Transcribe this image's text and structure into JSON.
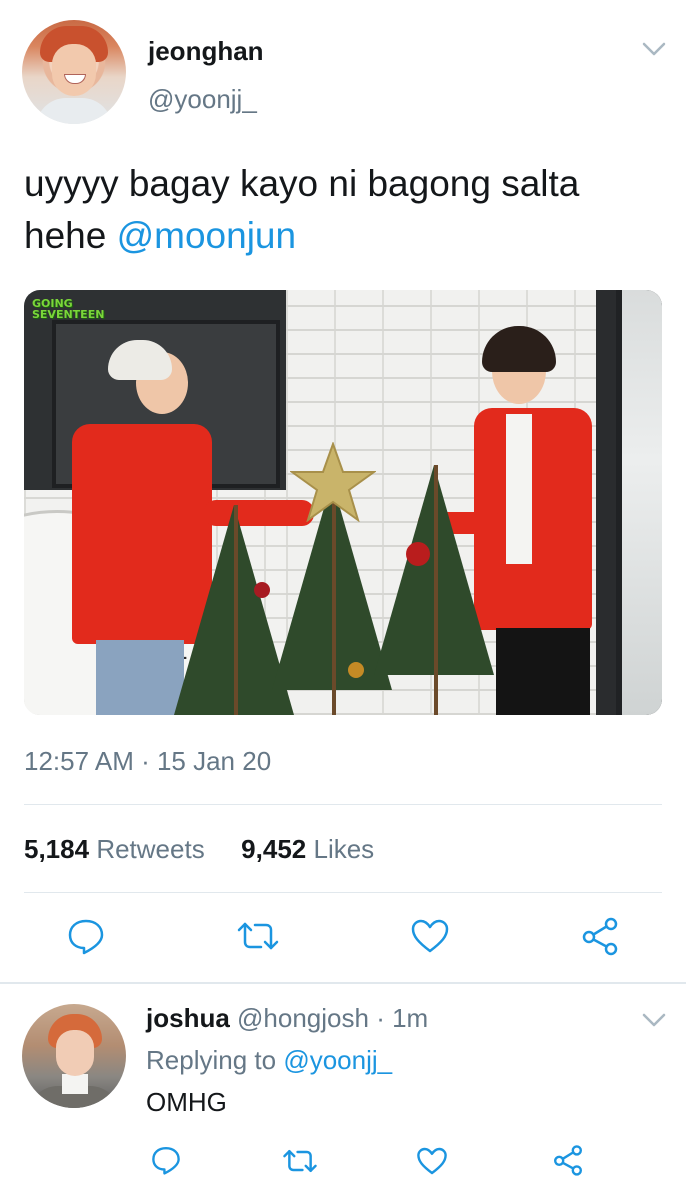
{
  "tweet": {
    "display_name": "jeonghan",
    "handle": "@yoonjj_",
    "text": "uyyyy bagay kayo ni bagong salta hehe",
    "mention": "@moonjun",
    "media_logo_line1": "GOING",
    "media_logo_line2": "SEVENTEEN",
    "timestamp": "12:57 AM · 15 Jan 20",
    "retweets_count": "5,184",
    "retweets_label": "Retweets",
    "likes_count": "9,452",
    "likes_label": "Likes"
  },
  "reply": {
    "display_name": "joshua",
    "handle": "@hongjosh",
    "time": "· 1m",
    "replying_label": "Replying to",
    "replying_mention": "@yoonjj_",
    "text": "OMHG"
  },
  "colors": {
    "text": "#14171a",
    "secondary": "#657786",
    "link": "#1b95e0",
    "divider": "#e1e8ed"
  },
  "icons": [
    "chevron-down-icon",
    "reply-icon",
    "retweet-icon",
    "like-icon",
    "share-icon"
  ]
}
